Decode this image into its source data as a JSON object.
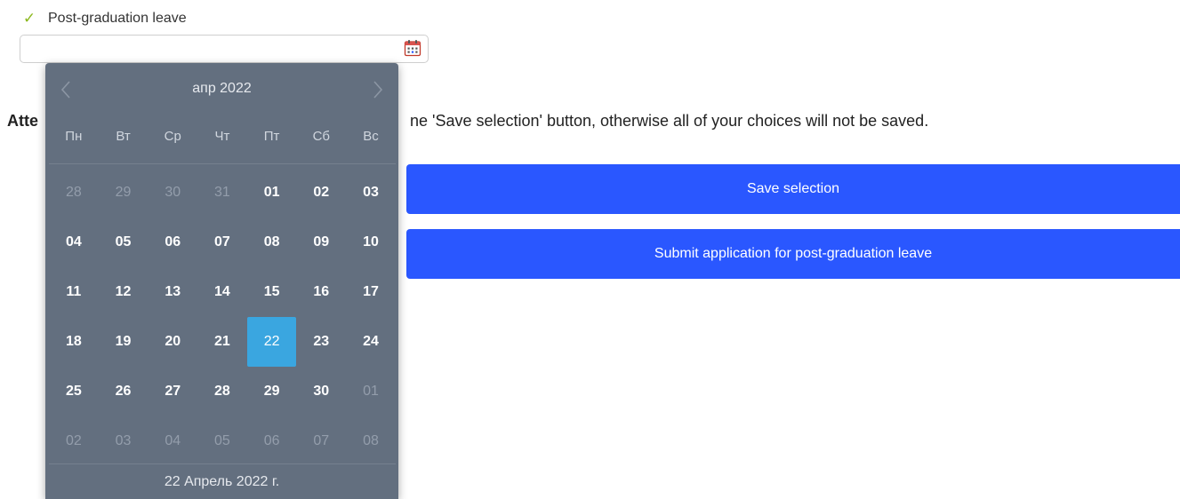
{
  "checkbox": {
    "label": "Post-graduation leave",
    "checked": true,
    "check_glyph": "✓",
    "check_color": "#8bb81e"
  },
  "date_input": {
    "value": "",
    "icon": "calendar-icon"
  },
  "attention": {
    "bold_part": "Atte",
    "rest_part": "ne 'Save selection' button, otherwise all of your choices will not be saved."
  },
  "buttons": {
    "save_label": "Save selection",
    "submit_label": "Submit application for post-graduation leave",
    "color": "#2a57ff"
  },
  "datepicker": {
    "month_title": "апр 2022",
    "prev_icon": "chevron-left-icon",
    "next_icon": "chevron-right-icon",
    "weekdays": [
      "Пн",
      "Вт",
      "Ср",
      "Чт",
      "Пт",
      "Сб",
      "Вс"
    ],
    "weeks": [
      [
        {
          "d": "28",
          "m": true
        },
        {
          "d": "29",
          "m": true
        },
        {
          "d": "30",
          "m": true
        },
        {
          "d": "31",
          "m": true
        },
        {
          "d": "01"
        },
        {
          "d": "02"
        },
        {
          "d": "03"
        }
      ],
      [
        {
          "d": "04"
        },
        {
          "d": "05"
        },
        {
          "d": "06"
        },
        {
          "d": "07"
        },
        {
          "d": "08"
        },
        {
          "d": "09"
        },
        {
          "d": "10"
        }
      ],
      [
        {
          "d": "11"
        },
        {
          "d": "12"
        },
        {
          "d": "13"
        },
        {
          "d": "14"
        },
        {
          "d": "15"
        },
        {
          "d": "16"
        },
        {
          "d": "17"
        }
      ],
      [
        {
          "d": "18"
        },
        {
          "d": "19"
        },
        {
          "d": "20"
        },
        {
          "d": "21"
        },
        {
          "d": "22",
          "s": true
        },
        {
          "d": "23"
        },
        {
          "d": "24"
        }
      ],
      [
        {
          "d": "25"
        },
        {
          "d": "26"
        },
        {
          "d": "27"
        },
        {
          "d": "28"
        },
        {
          "d": "29"
        },
        {
          "d": "30"
        },
        {
          "d": "01",
          "m": true
        }
      ],
      [
        {
          "d": "02",
          "m": true
        },
        {
          "d": "03",
          "m": true
        },
        {
          "d": "04",
          "m": true
        },
        {
          "d": "05",
          "m": true
        },
        {
          "d": "06",
          "m": true
        },
        {
          "d": "07",
          "m": true
        },
        {
          "d": "08",
          "m": true
        }
      ]
    ],
    "footer": "22 Апрель 2022 г.",
    "background_color": "#636f7f",
    "selected_color": "#3aa6e0"
  }
}
